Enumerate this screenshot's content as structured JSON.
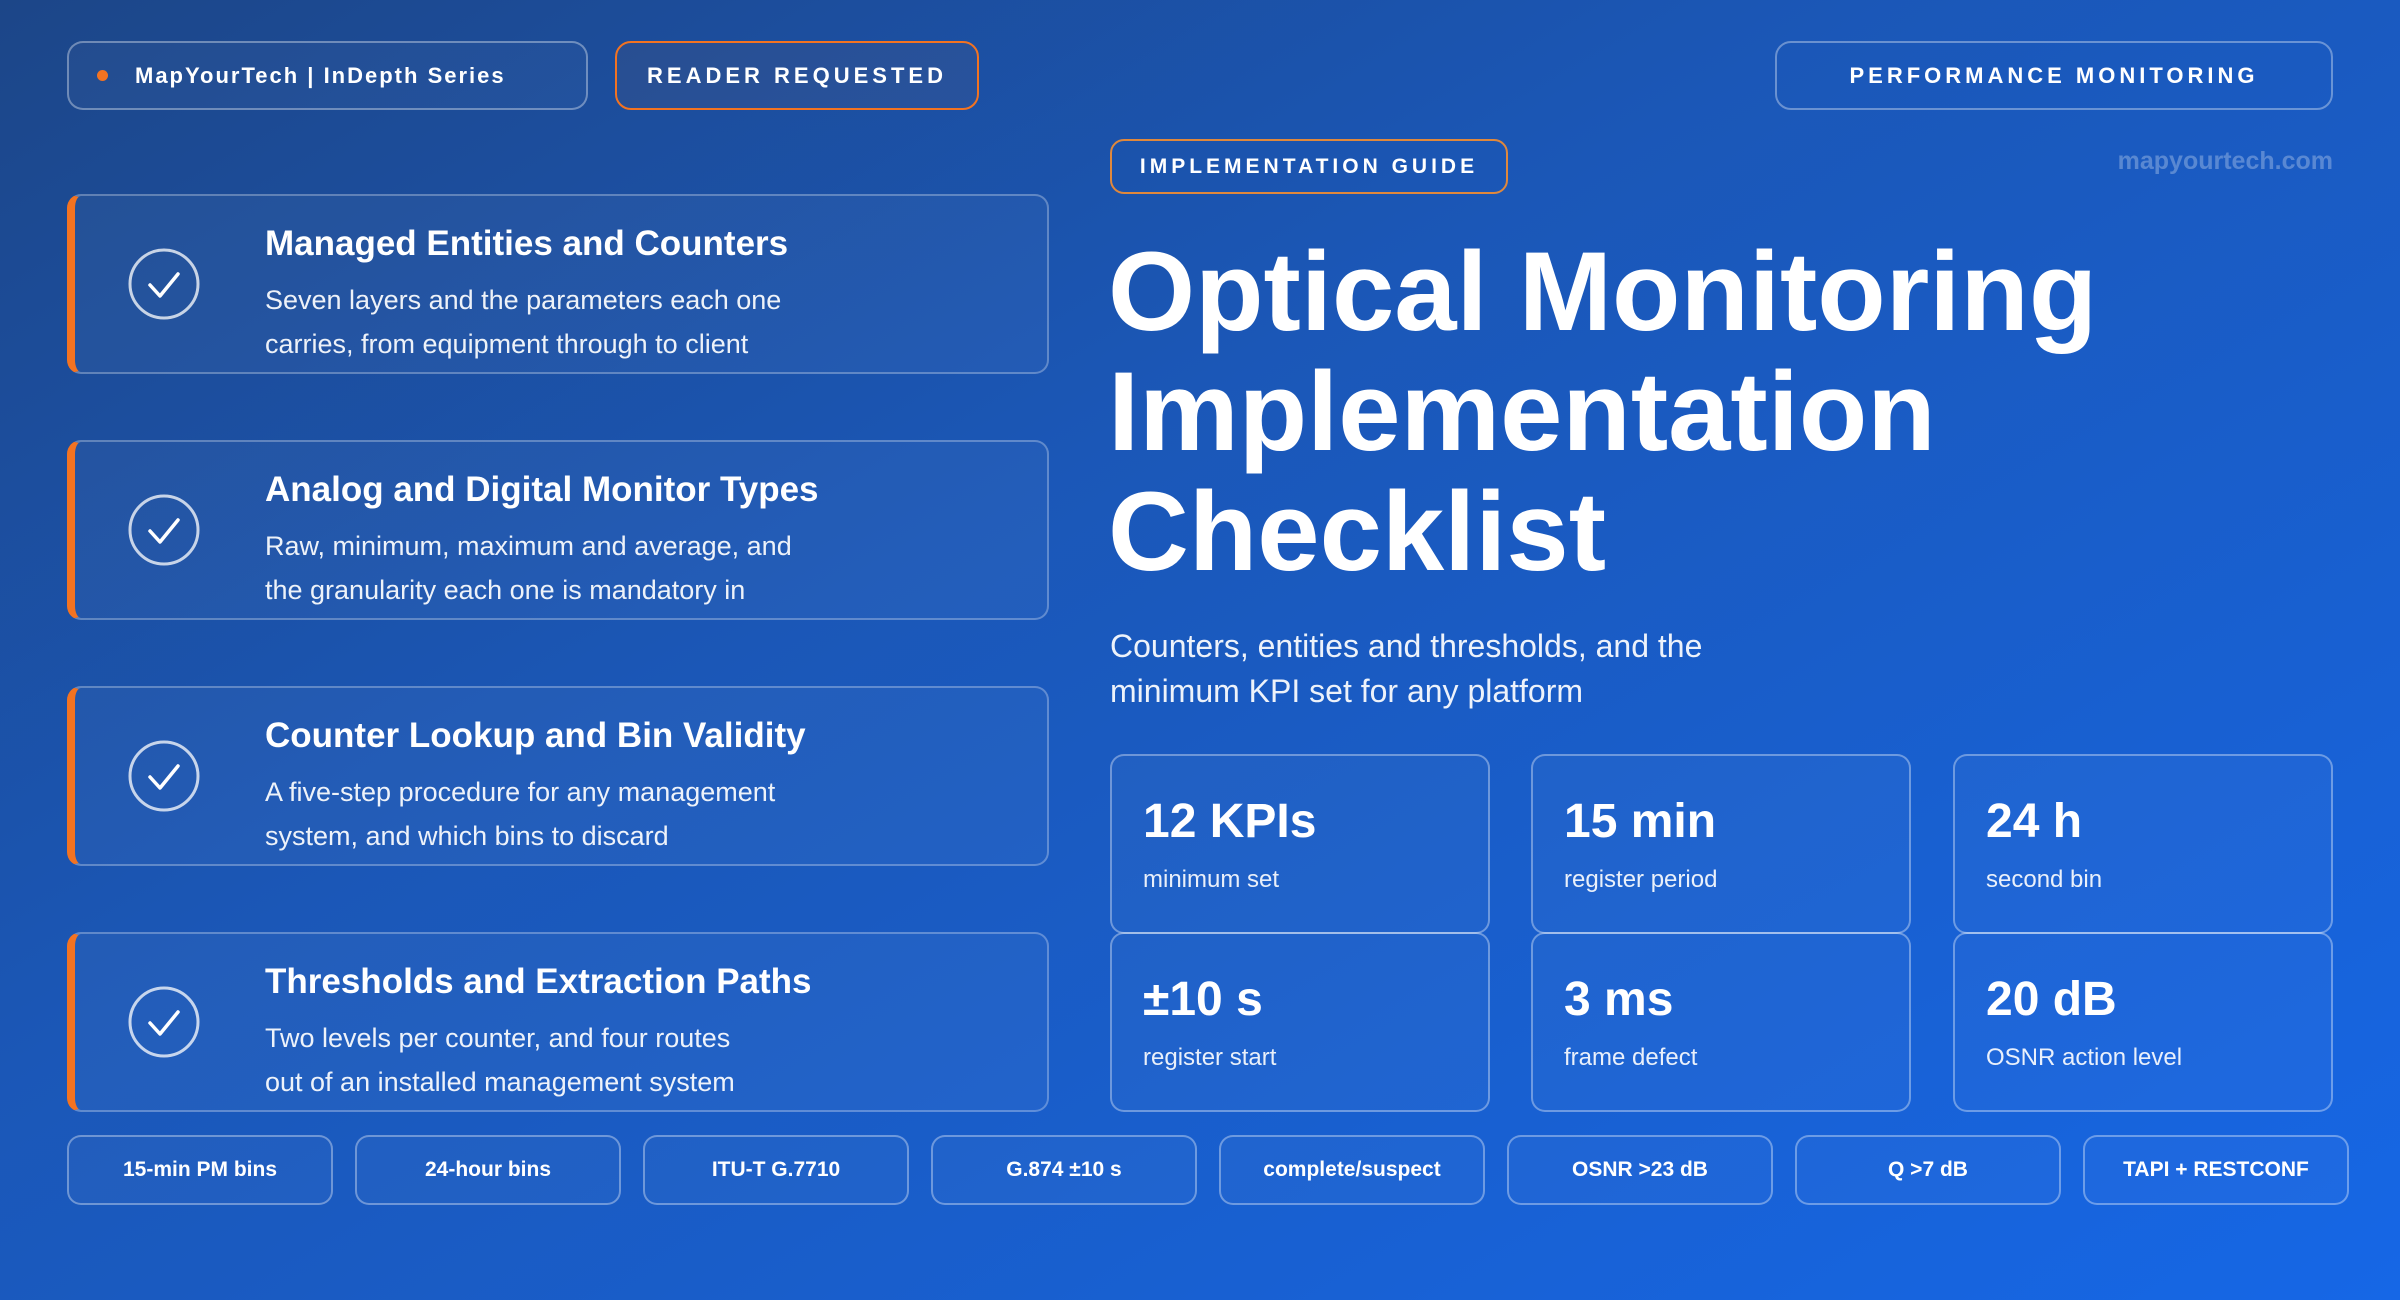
{
  "header": {
    "brand": "MapYourTech | InDepth Series",
    "reader_badge": "READER REQUESTED",
    "category_badge": "PERFORMANCE MONITORING",
    "guide_badge": "IMPLEMENTATION GUIDE",
    "site": "mapyourtech.com"
  },
  "checklist": [
    {
      "title": "Managed Entities and Counters",
      "line1": "Seven layers and the parameters each one",
      "line2": "carries, from equipment through to client"
    },
    {
      "title": "Analog and Digital Monitor Types",
      "line1": "Raw, minimum, maximum and average, and",
      "line2": "the granularity each one is mandatory in"
    },
    {
      "title": "Counter Lookup and Bin Validity",
      "line1": "A five-step procedure for any management",
      "line2": "system, and which bins to discard"
    },
    {
      "title": "Thresholds and Extraction Paths",
      "line1": "Two levels per counter, and four routes",
      "line2": "out of an installed management system"
    }
  ],
  "hero": {
    "title_line1": "Optical Monitoring",
    "title_line2": "Implementation",
    "title_line3": "Checklist",
    "subtitle_line1": "Counters, entities and thresholds, and the",
    "subtitle_line2": "minimum KPI set for any platform"
  },
  "stats": [
    {
      "value": "12 KPIs",
      "label": "minimum set"
    },
    {
      "value": "15 min",
      "label": "register period"
    },
    {
      "value": "24 h",
      "label": "second bin"
    },
    {
      "value": "±10 s",
      "label": "register start"
    },
    {
      "value": "3 ms",
      "label": "frame defect"
    },
    {
      "value": "20 dB",
      "label": "OSNR action level"
    }
  ],
  "tags": [
    "15-min PM bins",
    "24-hour bins",
    "ITU-T G.7710",
    "G.874 ±10 s",
    "complete/suspect",
    "OSNR >23 dB",
    "Q >7 dB",
    "TAPI + RESTCONF"
  ],
  "colors": {
    "accent": "#f37321",
    "bg_start": "#1c4688",
    "bg_end": "#1667e6"
  }
}
